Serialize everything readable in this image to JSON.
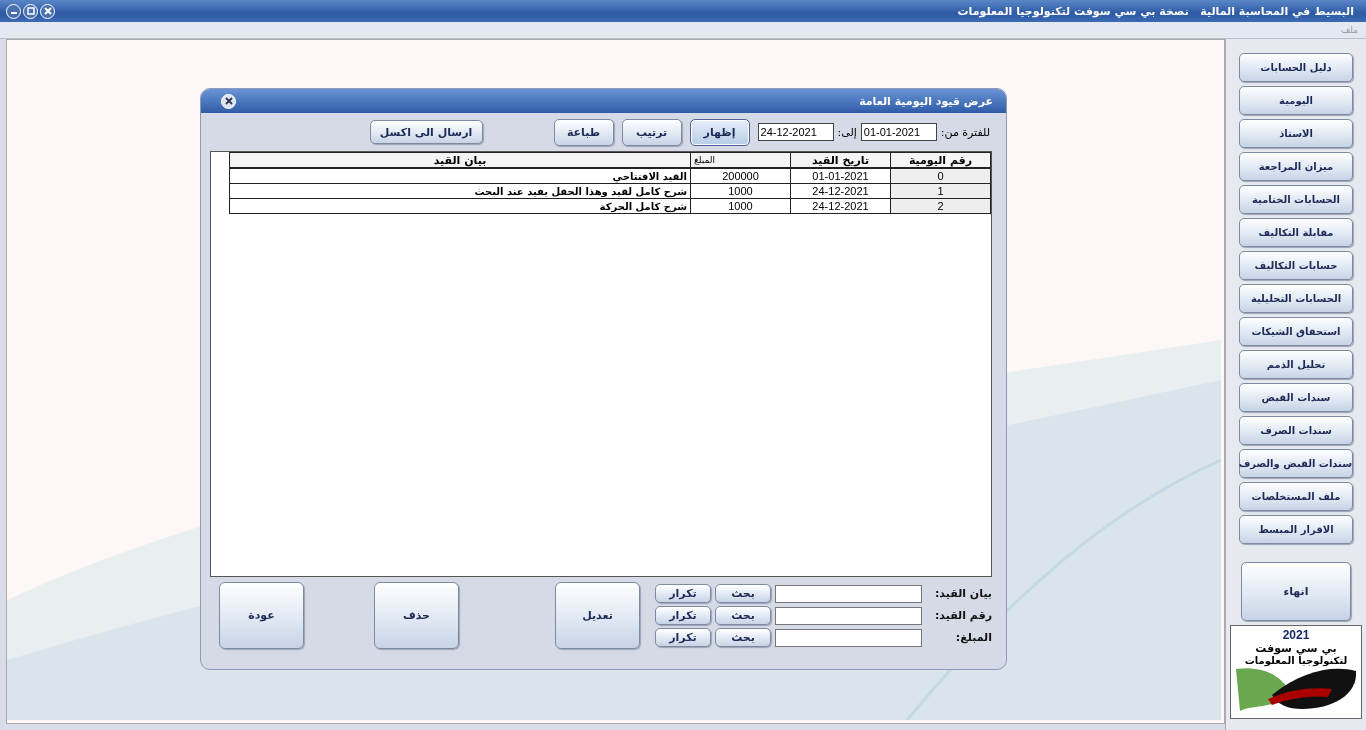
{
  "window": {
    "title": "البسيط في المحاسبة المالية   نصخة بي سي سوفت لتكنولوجيا المعلومات"
  },
  "menu": [
    {
      "label": "ملف"
    }
  ],
  "dialog": {
    "title": "عرض قيود اليومية العامة",
    "period": {
      "from_label": "للفترة من:",
      "from_value": "01-01-2021",
      "to_label": "إلى:",
      "to_value": "24-12-2021"
    },
    "toolbar_buttons": [
      {
        "label": "إظهار",
        "focused": true
      },
      {
        "label": "ترتيب",
        "focused": false
      },
      {
        "label": "طباعة",
        "focused": false
      },
      {
        "label": "ارسال الى اكسل",
        "focused": false
      }
    ],
    "table": {
      "columns": [
        "رقم اليومية",
        "تاريخ القيد",
        "المبلغ",
        "بيان القيد"
      ],
      "rows": [
        [
          "0",
          "01-01-2021",
          "200000",
          "القيد الافتتاحي"
        ],
        [
          "1",
          "24-12-2021",
          "1000",
          "شرح كامل لقيد وهذا الحقل يفيد عند البحث"
        ],
        [
          "2",
          "24-12-2021",
          "1000",
          "شرح كامل الحركة"
        ]
      ]
    },
    "search_rows": [
      {
        "label": "بيان القيد:",
        "buttons": [
          "بحث",
          "تكرار"
        ]
      },
      {
        "label": "رقم القيد:",
        "buttons": [
          "بحث",
          "تكرار"
        ]
      },
      {
        "label": "المبلغ:",
        "buttons": [
          "بحث",
          "تكرار"
        ]
      }
    ],
    "action_buttons": [
      "تعديل",
      "حذف",
      "عودة"
    ]
  },
  "sidebar": {
    "items": [
      "دليل الحسابات",
      "اليومية",
      "الاستاذ",
      "ميزان المراجعة",
      "الحسابات الختامية",
      "مقابلة التكاليف",
      "حسابات التكاليف",
      "الحسابات التحليلية",
      "استحقاق الشيكات",
      "تحليل الذمم",
      "سندات القبض",
      "سندات الصرف",
      "سندات القبض والصرف",
      "ملف المستخلصات",
      "الاقرار المبسط"
    ],
    "exit_button": "انهاء",
    "logo": {
      "year": "2021",
      "name": "بي سي سوفت",
      "tagline": "لتكنولوجيا المعلومات"
    }
  }
}
